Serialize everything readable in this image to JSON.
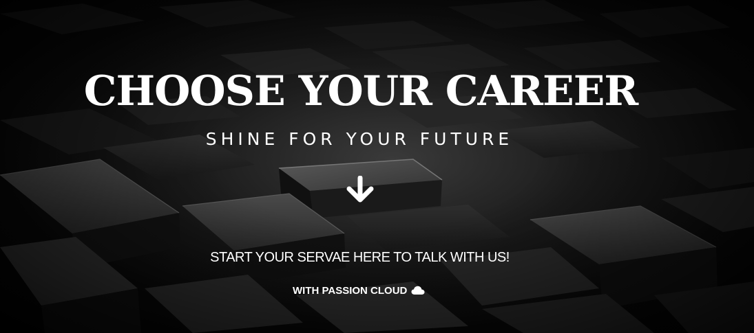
{
  "hero": {
    "title": "CHOOSE YOUR CAREER",
    "subtitle": "SHINE FOR YOUR FUTURE",
    "scroll_icon": "arrow-down-icon",
    "cta_text": "START YOUR SERVAE HERE TO TALK WITH US!",
    "credit_text": "WITH PASSION CLOUD",
    "credit_icon": "cloud-icon"
  },
  "colors": {
    "text": "#ffffff",
    "background": "#000000"
  }
}
